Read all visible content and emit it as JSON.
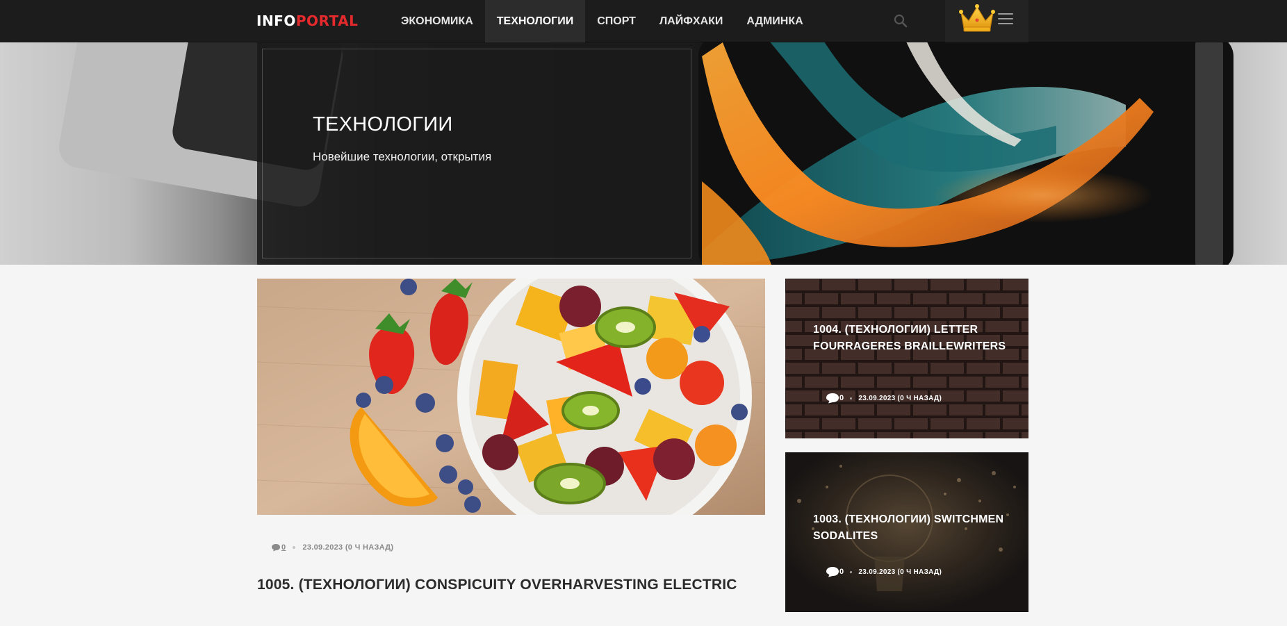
{
  "header": {
    "logo_part1": "INFO",
    "logo_part2": "PORTAL",
    "nav": [
      {
        "label": "ЭКОНОМИКА"
      },
      {
        "label": "ТЕХНОЛОГИИ",
        "active": true
      },
      {
        "label": "СПОРТ"
      },
      {
        "label": "ЛАЙФХАКИ"
      },
      {
        "label": "АДМИНКА"
      }
    ],
    "icons": [
      "search-icon",
      "crown-icon",
      "hamburger-icon"
    ]
  },
  "hero": {
    "title": "ТЕХНОЛОГИИ",
    "subtitle": "Новейшие технологии, открытия"
  },
  "main_article": {
    "comments": "0",
    "date": "23.09.2023 (0 Ч НАЗАД)",
    "title": "1005. (ТЕХНОЛОГИИ) CONSPICUITY OVERHARVESTING ELECTRIC"
  },
  "side_articles": [
    {
      "title": "1004. (ТЕХНОЛОГИИ) LETTER FOURRAGERES BRAILLEWRITERS",
      "comments": "0",
      "date": "23.09.2023 (0 Ч НАЗАД)"
    },
    {
      "title": "1003. (ТЕХНОЛОГИИ) SWITCHMEN SODALITES",
      "comments": "0",
      "date": "23.09.2023 (0 Ч НАЗАД)"
    }
  ],
  "colors": {
    "topbar": "#1c1c1c",
    "logo_accent": "#e42a2d",
    "page_bg": "#f5f5f6"
  }
}
